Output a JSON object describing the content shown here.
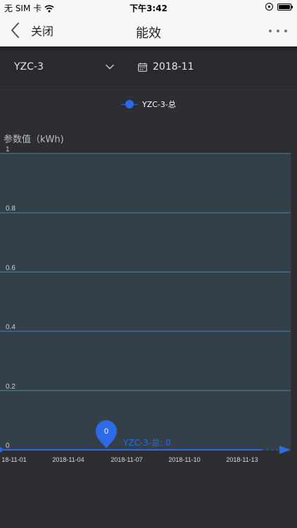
{
  "status_bar": {
    "carrier": "无 SIM 卡",
    "time": "下午3:42"
  },
  "nav": {
    "back_label": "关闭",
    "title": "能效"
  },
  "filters": {
    "device": "YZC-3",
    "month": "2018-11"
  },
  "colors": {
    "series": "#2d6be6",
    "plot_background": "#344048",
    "gridline": "#4a7fa8",
    "page_background": "#2e2d31"
  },
  "chart_data": {
    "type": "line",
    "ylabel": "参数值（kWh)",
    "ylim": [
      0,
      1
    ],
    "yticks": [
      "1",
      "0.8",
      "0.6",
      "0.4",
      "0.2",
      "0"
    ],
    "x_tick_labels": [
      "18-11-01",
      "2018-11-04",
      "2018-11-07",
      "2018-11-10",
      "2018-11-13"
    ],
    "series": [
      {
        "name": "YZC-3-总",
        "values": [
          0,
          0,
          0,
          0,
          0,
          0,
          0,
          0,
          0,
          0,
          0,
          0,
          0,
          0,
          0
        ]
      }
    ],
    "marker": {
      "label": "0",
      "tooltip": "YZC-3-总: 0"
    }
  }
}
